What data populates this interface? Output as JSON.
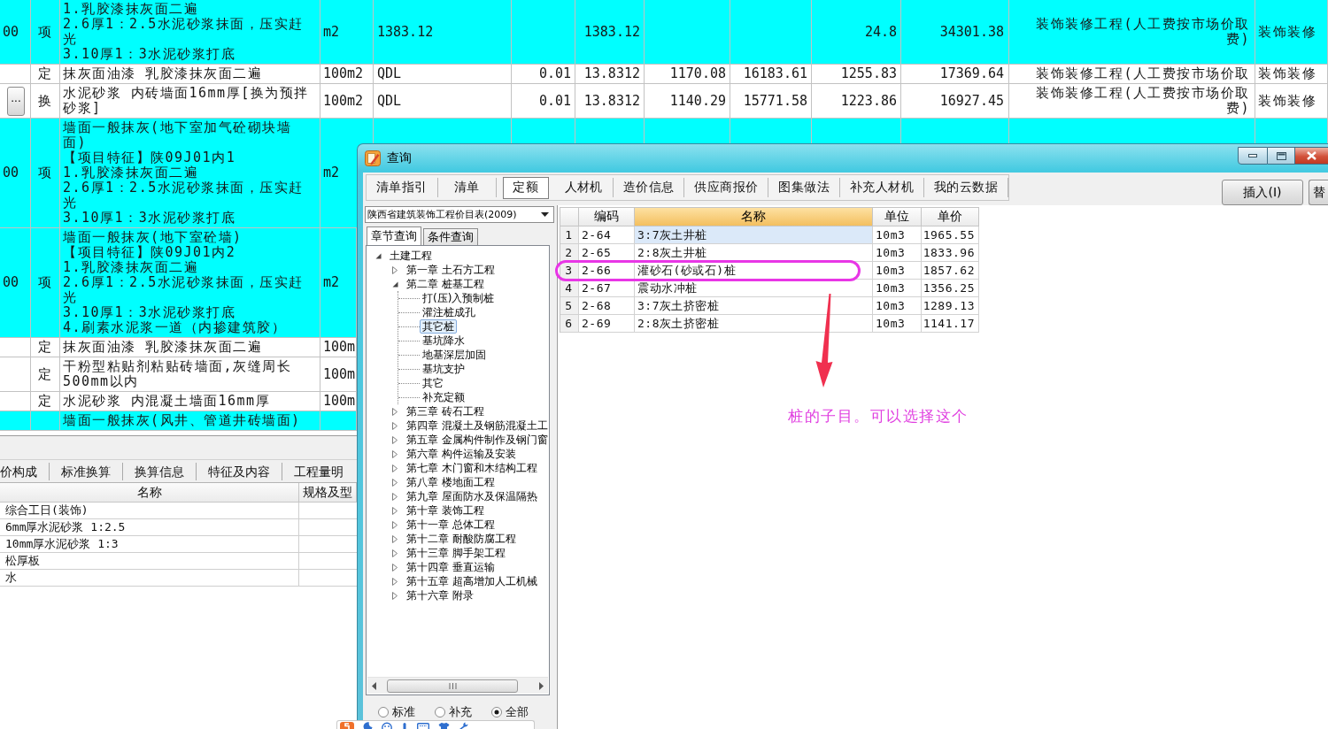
{
  "main_table": {
    "rows": [
      {
        "kind": "bill",
        "cells": {
          "column_1": "00",
          "column_2": "项",
          "column_3": [
            "1.乳胶漆抹灰面二遍",
            "2.6厚1：2.5水泥砂浆抹面，压实赶光",
            "3.10厚1：3水泥砂浆打底"
          ],
          "column_4": "m2",
          "column_5": "1383.12",
          "column_7": "1383.12",
          "column_10": "24.8",
          "column_11": "34301.38",
          "column_12": "装饰装修工程(人工费按市场价取费)",
          "column_13": "装饰装修"
        }
      },
      {
        "kind": "quota",
        "cells": {
          "column_2": "定",
          "column_3": [
            "抹灰面油漆 乳胶漆抹灰面二遍"
          ],
          "column_4": "100m2",
          "column_5": "QDL",
          "column_6": "0.01",
          "column_7": "13.8312",
          "column_8": "1170.08",
          "column_9": "16183.61",
          "column_10": "1255.83",
          "column_11": "17369.64",
          "column_12": "装饰装修工程(人工费按市场价取",
          "column_13": "装饰装修"
        }
      },
      {
        "kind": "quota",
        "more_button": "...",
        "cells": {
          "column_2": "换",
          "column_3": [
            "水泥砂浆 内砖墙面16mm厚[换为预拌砂浆]"
          ],
          "column_4": "100m2",
          "column_5": "QDL",
          "column_6": "0.01",
          "column_7": "13.8312",
          "column_8": "1140.29",
          "column_9": "15771.58",
          "column_10": "1223.86",
          "column_11": "16927.45",
          "column_12": "装饰装修工程(人工费按市场价取费)",
          "column_13": "装饰装修"
        }
      },
      {
        "kind": "bill",
        "cells": {
          "column_1": "00",
          "column_2": "项",
          "column_3": [
            "墙面一般抹灰(地下室加气砼砌块墙面)",
            "【项目特征】陕09J01内1",
            "1.乳胶漆抹灰面二遍",
            "2.6厚1：2.5水泥砂浆抹面，压实赶光",
            "3.10厚1：3水泥砂浆打底"
          ],
          "column_4": "m2"
        }
      },
      {
        "kind": "bill",
        "cells": {
          "column_1": "00",
          "column_2": "项",
          "column_3": [
            "墙面一般抹灰(地下室砼墙)",
            "【项目特征】陕09J01内2",
            "1.乳胶漆抹灰面二遍",
            "2.6厚1：2.5水泥砂浆抹面，压实赶光",
            "3.10厚1：3水泥砂浆打底",
            "4.刷素水泥浆一道（内掺建筑胶）"
          ],
          "column_4": "m2"
        }
      },
      {
        "kind": "quota",
        "cells": {
          "column_2": "定",
          "column_3": [
            "抹灰面油漆 乳胶漆抹灰面二遍"
          ],
          "column_4": "100m"
        }
      },
      {
        "kind": "quota",
        "cells": {
          "column_2": "定",
          "column_3": [
            "干粉型粘贴剂粘贴砖墙面,灰缝周长500mm以内"
          ],
          "column_4": "100m"
        }
      },
      {
        "kind": "quota",
        "cells": {
          "column_2": "定",
          "column_3": [
            "水泥砂浆 内混凝土墙面16mm厚"
          ],
          "column_4": "100m"
        }
      },
      {
        "kind": "bill",
        "cells": {
          "column_3": [
            "墙面一般抹灰(风井、管道井砖墙面)"
          ]
        }
      }
    ]
  },
  "detail_panel": {
    "tabs": [
      "价构成",
      "标准换算",
      "换算信息",
      "特征及内容",
      "工程量明"
    ],
    "columns": [
      "名称",
      "规格及型"
    ],
    "rows": [
      {
        "name": "综合工日(装饰)"
      },
      {
        "name": "6mm厚水泥砂浆 1:2.5"
      },
      {
        "name": "10mm厚水泥砂浆 1:3"
      },
      {
        "name": "松厚板"
      },
      {
        "name": "水"
      }
    ]
  },
  "dialog": {
    "title": "查询",
    "tabs": [
      {
        "label": "清单指引",
        "selected": false
      },
      {
        "label": "清单",
        "selected": false
      },
      {
        "label": "定额",
        "selected": true
      },
      {
        "label": "人材机",
        "selected": false
      },
      {
        "label": "造价信息",
        "selected": false
      },
      {
        "label": "供应商报价",
        "selected": false
      },
      {
        "label": "图集做法",
        "selected": false
      },
      {
        "label": "补充人材机",
        "selected": false
      },
      {
        "label": "我的云数据",
        "selected": false
      }
    ],
    "buttons": [
      "插入(I)",
      "替"
    ],
    "library_select": {
      "value": "陕西省建筑装饰工程价目表(2009)"
    },
    "search_tabs": [
      {
        "label": "章节查询",
        "selected": true
      },
      {
        "label": "条件查询",
        "selected": false
      }
    ],
    "tree": [
      {
        "label": "土建工程",
        "expanded": true,
        "selected": false,
        "children": [
          {
            "label": "第一章 土石方工程",
            "expanded": false,
            "selected": false
          },
          {
            "label": "第二章 桩基工程",
            "expanded": true,
            "selected": false,
            "children": [
              {
                "label": "打(压)入预制桩",
                "selected": false
              },
              {
                "label": "灌注桩成孔",
                "selected": false
              },
              {
                "label": "其它桩",
                "selected": true
              },
              {
                "label": "基坑降水",
                "selected": false
              },
              {
                "label": "地基深层加固",
                "selected": false
              },
              {
                "label": "基坑支护",
                "selected": false
              },
              {
                "label": "其它",
                "selected": false
              },
              {
                "label": "补充定额",
                "selected": false
              }
            ]
          },
          {
            "label": "第三章 砖石工程",
            "expanded": false,
            "selected": false
          },
          {
            "label": "第四章 混凝土及钢筋混凝土工",
            "expanded": false,
            "selected": false
          },
          {
            "label": "第五章 金属构件制作及钢门窗",
            "expanded": false,
            "selected": false
          },
          {
            "label": "第六章 构件运输及安装",
            "expanded": false,
            "selected": false
          },
          {
            "label": "第七章 木门窗和木结构工程",
            "expanded": false,
            "selected": false
          },
          {
            "label": "第八章 楼地面工程",
            "expanded": false,
            "selected": false
          },
          {
            "label": "第九章 屋面防水及保温隔热",
            "expanded": false,
            "selected": false
          },
          {
            "label": "第十章 装饰工程",
            "expanded": false,
            "selected": false
          },
          {
            "label": "第十一章 总体工程",
            "expanded": false,
            "selected": false
          },
          {
            "label": "第十二章 耐酸防腐工程",
            "expanded": false,
            "selected": false
          },
          {
            "label": "第十三章 脚手架工程",
            "expanded": false,
            "selected": false
          },
          {
            "label": "第十四章 垂直运输",
            "expanded": false,
            "selected": false
          },
          {
            "label": "第十五章 超高增加人工机械",
            "expanded": false,
            "selected": false
          },
          {
            "label": "第十六章 附录",
            "expanded": false,
            "selected": false
          }
        ]
      }
    ],
    "filter": [
      {
        "label": "标准",
        "selected": false
      },
      {
        "label": "补充",
        "selected": false
      },
      {
        "label": "全部",
        "selected": true
      }
    ],
    "grid": {
      "columns": [
        {
          "label": "编码",
          "selected": false
        },
        {
          "label": "名称",
          "selected": true
        },
        {
          "label": "单位",
          "selected": false
        },
        {
          "label": "单价",
          "selected": false
        }
      ],
      "rows": [
        {
          "number": "1",
          "code": "2-64",
          "name": "3:7灰土井桩",
          "unit": "10m3",
          "price": "1965.55",
          "selected": true
        },
        {
          "number": "2",
          "code": "2-65",
          "name": "2:8灰土井桩",
          "unit": "10m3",
          "price": "1833.96",
          "selected": false
        },
        {
          "number": "3",
          "code": "2-66",
          "name": "灌砂石(砂或石)桩",
          "unit": "10m3",
          "price": "1857.62",
          "selected": false
        },
        {
          "number": "4",
          "code": "2-67",
          "name": "震动水冲桩",
          "unit": "10m3",
          "price": "1356.25",
          "selected": false
        },
        {
          "number": "5",
          "code": "2-68",
          "name": "3:7灰土挤密桩",
          "unit": "10m3",
          "price": "1289.13",
          "selected": false
        },
        {
          "number": "6",
          "code": "2-69",
          "name": "2:8灰土挤密桩",
          "unit": "10m3",
          "price": "1141.17",
          "selected": false
        }
      ]
    }
  },
  "annotation": {
    "text": "桩的子目。可以选择这个"
  }
}
